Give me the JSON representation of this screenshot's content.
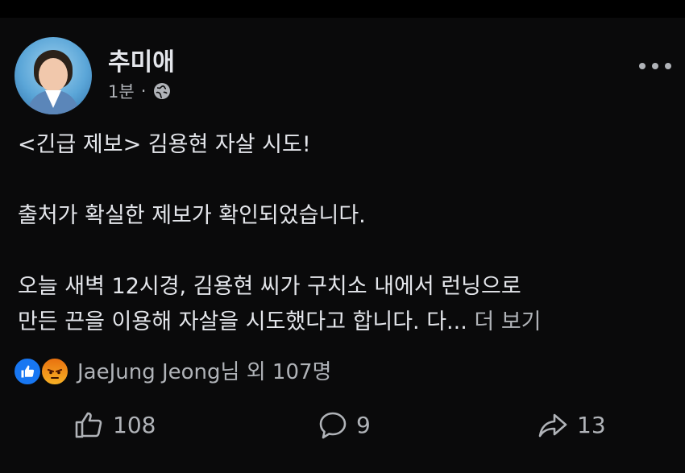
{
  "post": {
    "author": "추미애",
    "time": "1분",
    "separator": "·",
    "audience_icon": "globe-icon",
    "more_icon": "more-horizontal-icon",
    "content": {
      "line1": "<긴급 제보> 김용현 자살 시도!",
      "line2": "출처가 확실한 제보가 확인되었습니다.",
      "line3": "오늘 새벽 12시경, 김용현 씨가 구치소 내에서 런닝으로",
      "line4": "만든 끈을 이용해 자살을 시도했다고 합니다. 다...",
      "see_more": "더 보기"
    },
    "reactions": {
      "icons": [
        "like-icon",
        "angry-icon"
      ],
      "text": "JaeJung Jeong님 외 107명"
    },
    "actions": {
      "like_count": "108",
      "comment_count": "9",
      "share_count": "13"
    }
  },
  "colors": {
    "background": "#0a0a0b",
    "text_primary": "#e4e6eb",
    "text_secondary": "#b0b3b8",
    "like_blue": "#1877f2",
    "angry_orange": "#f7b125"
  }
}
